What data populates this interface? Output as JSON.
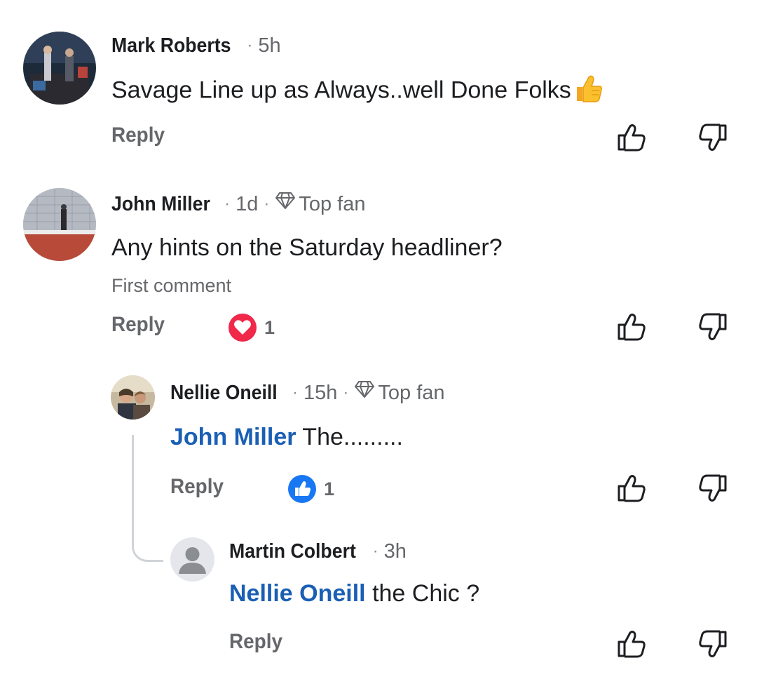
{
  "comments": [
    {
      "author": "Mark Roberts",
      "time": "5h",
      "text": "Savage Line up as Always..well Done Folks",
      "emoji": "thumbs-up-emoji",
      "reply_label": "Reply"
    },
    {
      "author": "John Miller",
      "time": "1d",
      "badge": "Top fan",
      "text": "Any hints on the Saturday headliner?",
      "subtext": "First comment",
      "reply_label": "Reply",
      "reaction": {
        "type": "heart-reaction-icon",
        "count": "1"
      }
    },
    {
      "author": "Nellie Oneill",
      "time": "15h",
      "badge": "Top fan",
      "mention": "John Miller",
      "text": " The.........",
      "reply_label": "Reply",
      "reaction": {
        "type": "like-reaction-icon",
        "count": "1"
      }
    },
    {
      "author": "Martin Colbert",
      "time": "3h",
      "mention": "Nellie Oneill",
      "text": " the Chic ?",
      "reply_label": "Reply"
    }
  ],
  "separator": "·",
  "colors": {
    "mention": "#1a5fb4",
    "meta": "#65676b",
    "heart": "#f0284a",
    "like": "#1877f2"
  }
}
